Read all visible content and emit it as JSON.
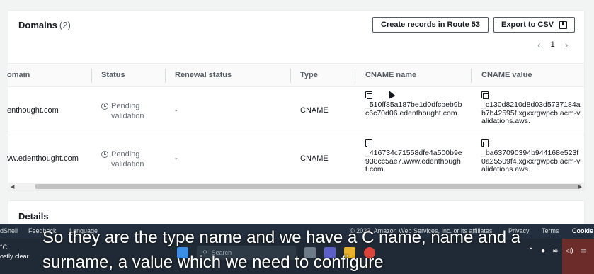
{
  "panel": {
    "title": "Domains",
    "count": "(2)",
    "buttons": {
      "route53": "Create records in Route 53",
      "export": "Export to CSV"
    },
    "pagination": {
      "prev": "‹",
      "page": "1",
      "next": "›"
    }
  },
  "table": {
    "headers": [
      "omain",
      "Status",
      "Renewal status",
      "Type",
      "CNAME name",
      "CNAME value"
    ],
    "rows": [
      {
        "domain": "enthought.com",
        "status": "Pending validation",
        "renewal": "-",
        "type": "CNAME",
        "cname_name": "_510ff85a187be1d0dfcbeb9bc6c70d06.edenthought.com.",
        "cname_value": "_c130d8210d8d03d5737184ab7b42595f.xgxxrgwpcb.acm-validations.aws."
      },
      {
        "domain": "vw.edenthought.com",
        "status": "Pending validation",
        "renewal": "-",
        "type": "CNAME",
        "cname_name": "_416734c71558dfe4a500b9e938cc5ae7.www.edenthought.com.",
        "cname_value": "_ba637090394b944168e523f0a25509f4.xgxxrgwpcb.acm-validations.aws."
      }
    ]
  },
  "details": {
    "title": "Details"
  },
  "footer": {
    "cloudshell": "dShell",
    "feedback": "Feedback",
    "language": "Language",
    "copyright": "© 2023, Amazon Web Services, Inc. or its affiliates.",
    "privacy": "Privacy",
    "terms": "Terms",
    "cookie": "Cookie"
  },
  "taskbar": {
    "weather_temp": "°C",
    "weather_desc": "ostly clear",
    "search_placeholder": "Search"
  },
  "caption": "So they are the type name and we have a C name, name and a surname, a value which we need to configure",
  "colors": {
    "footer_bg": "#232f3e",
    "taskbar_bg": "#202a36",
    "accent": "#ff9900"
  }
}
